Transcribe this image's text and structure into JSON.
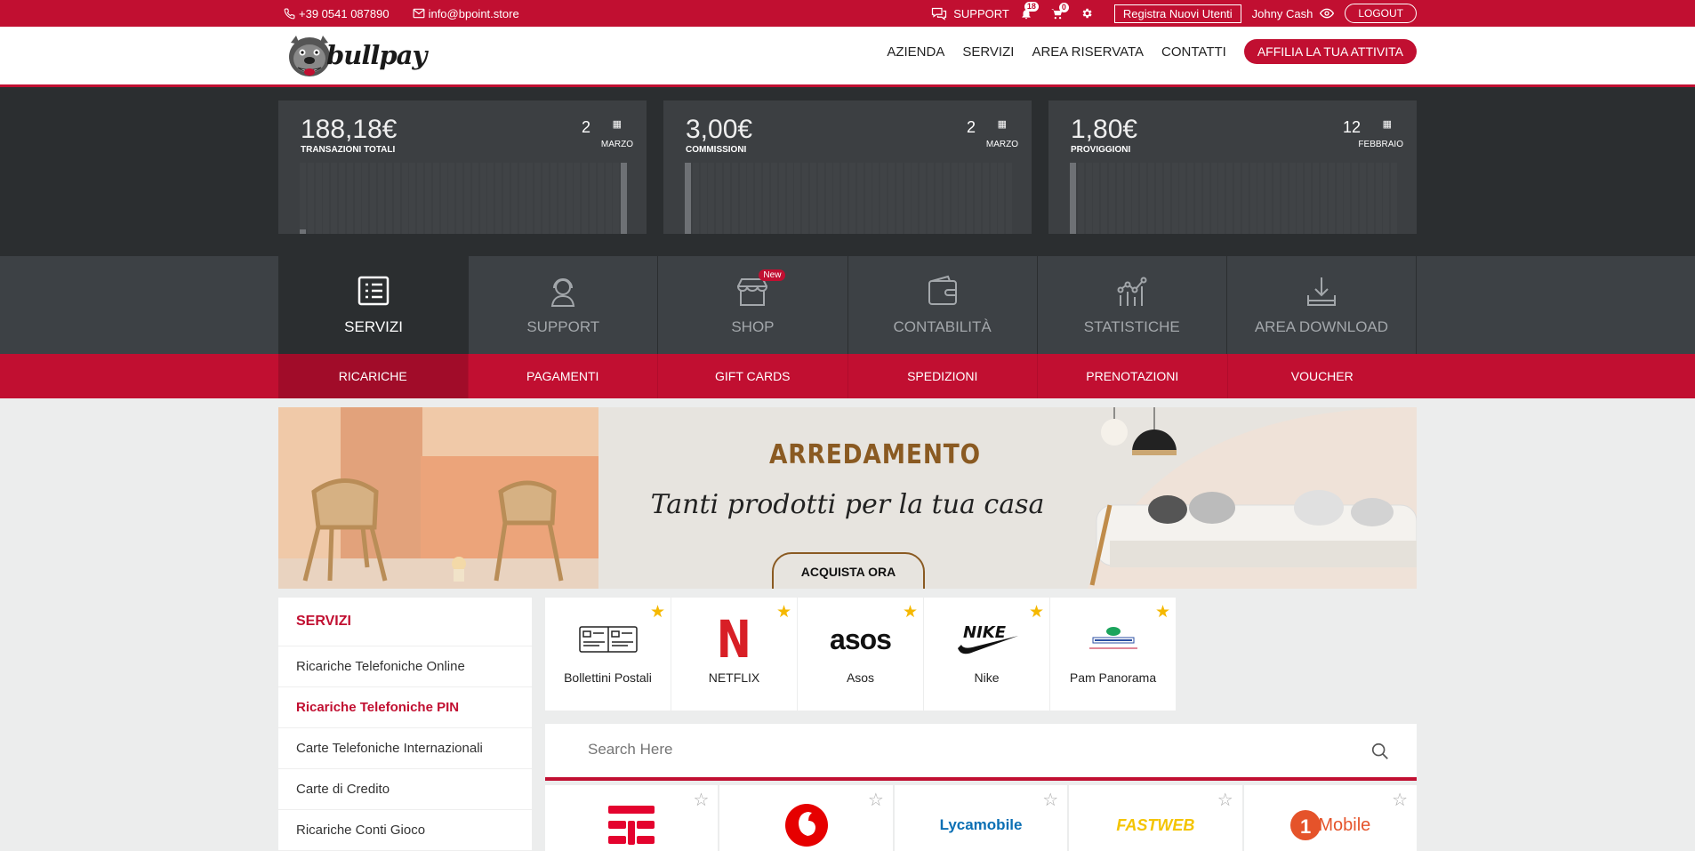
{
  "topbar": {
    "phone": "+39 0541 087890",
    "email": "info@bpoint.store",
    "support": "SUPPORT",
    "notif_count": "18",
    "cart_count": "0",
    "register_label": "Registra Nuovi Utenti",
    "user_name": "Johny Cash",
    "logout_label": "LOGOUT"
  },
  "header": {
    "logo_text": "bullpay",
    "nav": [
      "AZIENDA",
      "SERVIZI",
      "AREA RISERVATA",
      "CONTATTI"
    ],
    "cta": "AFFILIA LA TUA ATTIVITA"
  },
  "stats": [
    {
      "value": "188,18€",
      "label": "TRANSAZIONI TOTALI",
      "day": "2",
      "month": "MARZO",
      "bars": [
        0.06,
        0,
        0,
        0,
        0,
        0,
        0,
        0,
        0,
        0,
        0,
        0,
        0,
        0,
        0,
        0,
        0,
        0,
        0,
        0,
        0,
        0,
        0,
        0,
        0,
        0,
        0,
        0,
        0,
        0,
        0,
        0,
        0,
        0,
        0,
        0,
        0,
        0,
        0,
        0,
        0,
        1.0
      ]
    },
    {
      "value": "3,00€",
      "label": "COMMISSIONI",
      "day": "2",
      "month": "MARZO",
      "bars": [
        1.0
      ]
    },
    {
      "value": "1,80€",
      "label": "PROVIGGIONI",
      "day": "12",
      "month": "FEBBRAIO",
      "bars": [
        1.0
      ]
    }
  ],
  "categories": [
    {
      "label": "SERVIZI",
      "icon": "list-icon",
      "active": true
    },
    {
      "label": "SUPPORT",
      "icon": "support-agent-icon"
    },
    {
      "label": "SHOP",
      "icon": "store-icon",
      "badge": "New"
    },
    {
      "label": "CONTABILITÀ",
      "icon": "wallet-icon"
    },
    {
      "label": "STATISTICHE",
      "icon": "chart-icon"
    },
    {
      "label": "AREA DOWNLOAD",
      "icon": "download-icon"
    }
  ],
  "subnav": [
    "RICARICHE",
    "PAGAMENTI",
    "GIFT CARDS",
    "SPEDIZIONI",
    "PRENOTAZIONI",
    "VOUCHER"
  ],
  "banner": {
    "title": "ARREDAMENTO",
    "subtitle": "Tanti prodotti per la tua casa",
    "button": "ACQUISTA ORA"
  },
  "sidebar": {
    "title": "SERVIZI",
    "items": [
      "Ricariche Telefoniche Online",
      "Ricariche Telefoniche PIN",
      "Carte Telefoniche Internazionali",
      "Carte di Credito",
      "Ricariche Conti Gioco"
    ]
  },
  "favorites": [
    "Bollettini Postali",
    "NETFLIX",
    "Asos",
    "Nike",
    "Pam Panorama"
  ],
  "search": {
    "placeholder": "Search Here"
  },
  "products": [
    "TIM",
    "Vodafone",
    "Lycamobile",
    "Fastweb",
    "1Mobile"
  ],
  "product_logo_text": {
    "lyca": "Lycamobile",
    "fastweb": "FASTWEB",
    "one": "Mobile",
    "asos": "asos",
    "netflix": "N"
  },
  "colors": {
    "brand": "#c10f31",
    "dark": "#2b2e30",
    "star": "#f5b800"
  }
}
